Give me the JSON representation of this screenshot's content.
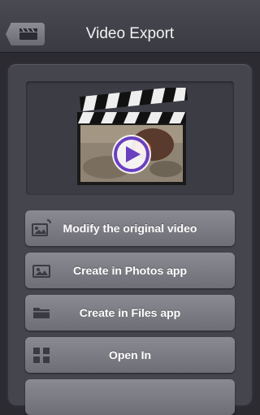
{
  "nav": {
    "title": "Video Export",
    "back_icon": "clapperboard-icon"
  },
  "preview": {
    "icon": "clapperboard-play-icon",
    "accent": "#6a3fc0"
  },
  "actions": [
    {
      "label": "Modify the original video",
      "icon": "photo-edit-icon"
    },
    {
      "label": "Create in Photos app",
      "icon": "photo-icon"
    },
    {
      "label": "Create in Files app",
      "icon": "folder-icon"
    },
    {
      "label": "Open In",
      "icon": "grid-icon"
    }
  ]
}
